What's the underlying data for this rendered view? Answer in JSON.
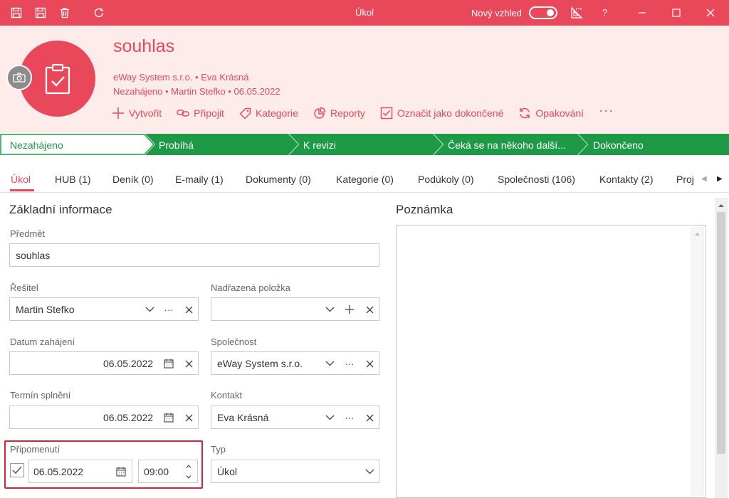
{
  "window": {
    "title": "Úkol",
    "new_look_label": "Nový vzhled",
    "help_label": "?"
  },
  "record": {
    "title": "souhlas",
    "subtitle_line1": "eWay System s.r.o. • Eva Krásná",
    "subtitle_line2": "Nezahájeno • Martin Stefko • 06.05.2022"
  },
  "actions": [
    {
      "label": "Vytvořit",
      "icon": "plus-icon"
    },
    {
      "label": "Připojit",
      "icon": "link-icon"
    },
    {
      "label": "Kategorie",
      "icon": "tag-icon"
    },
    {
      "label": "Reporty",
      "icon": "pie-chart-icon"
    },
    {
      "label": "Označit jako dokončené",
      "icon": "checkbox-icon"
    },
    {
      "label": "Opakování",
      "icon": "repeat-icon"
    }
  ],
  "more_label": "···",
  "stages": [
    {
      "label": "Nezahájeno",
      "active": true
    },
    {
      "label": "Probíhá",
      "active": false
    },
    {
      "label": "K revizi",
      "active": false
    },
    {
      "label": "Čeká se na někoho další...",
      "active": false
    },
    {
      "label": "Dokončeno",
      "active": false
    }
  ],
  "tabs": [
    {
      "label": "Úkol",
      "active": true
    },
    {
      "label": "HUB (1)"
    },
    {
      "label": "Deník (0)"
    },
    {
      "label": "E-maily (1)"
    },
    {
      "label": "Dokumenty (0)"
    },
    {
      "label": "Kategorie (0)"
    },
    {
      "label": "Podúkoly (0)"
    },
    {
      "label": "Společnosti (106)"
    },
    {
      "label": "Kontakty (2)"
    },
    {
      "label": "Proj"
    }
  ],
  "form": {
    "section_title": "Základní informace",
    "notes_title": "Poznámka",
    "subject": {
      "label": "Předmět",
      "value": "souhlas"
    },
    "solver": {
      "label": "Řešitel",
      "value": "Martin Stefko"
    },
    "parent": {
      "label": "Nadřazená položka",
      "value": ""
    },
    "start_date": {
      "label": "Datum zahájení",
      "value": "06.05.2022"
    },
    "company": {
      "label": "Společnost",
      "value": "eWay System s.r.o."
    },
    "due_date": {
      "label": "Termín splnění",
      "value": "06.05.2022"
    },
    "contact": {
      "label": "Kontakt",
      "value": "Eva Krásná"
    },
    "reminder": {
      "label": "Připomenutí",
      "checked": true,
      "date": "06.05.2022",
      "time": "09:00"
    },
    "type": {
      "label": "Typ",
      "value": "Úkol"
    }
  },
  "colors": {
    "accent": "#e8485a",
    "header_bg": "#fdecea",
    "stage_green": "#1e9a47",
    "highlight_red": "#d9213a"
  }
}
